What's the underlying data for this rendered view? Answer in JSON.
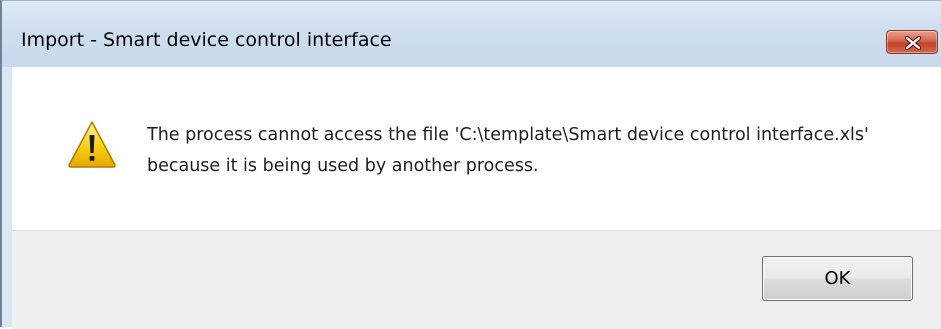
{
  "window": {
    "title": "Import - Smart device control interface"
  },
  "message": {
    "text": "The process cannot access the file 'C:\\template\\Smart device control interface.xls' because it is being used by another process."
  },
  "buttons": {
    "ok_label": "OK"
  },
  "icons": {
    "dialog_icon": "warning-icon",
    "close_icon": "close-icon"
  },
  "colors": {
    "close_button": "#c3432a",
    "warning_fill": "#f5c400",
    "button_area": "#f0f0f0"
  }
}
